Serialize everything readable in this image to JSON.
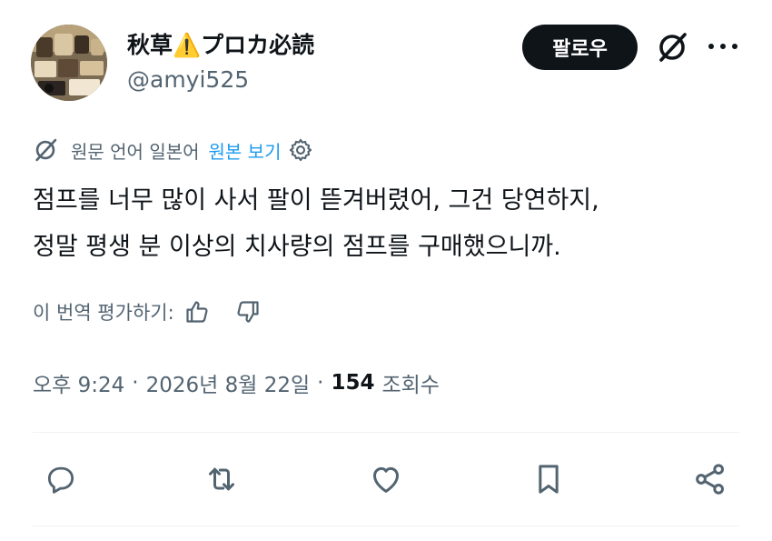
{
  "author": {
    "display_name": "秋草⚠️プロカ必読",
    "handle": "@amyi525",
    "avatar": "profile-avatar-image"
  },
  "header": {
    "follow_label": "팔로우",
    "grok_icon": "grok-icon",
    "more_icon": "more-icon"
  },
  "translation": {
    "icon": "translate-icon",
    "label": "원문 언어 일본어",
    "link": "원본 보기",
    "settings_icon": "gear-icon"
  },
  "tweet": {
    "lines": [
      "점프를 너무 많이 사서 팔이 뜯겨버렸어, 그건 당연하지,",
      "정말 평생 분 이상의 치사량의 점프를 구매했으니까."
    ]
  },
  "rating": {
    "label": "이 번역 평가하기:",
    "up_icon": "thumbs-up-icon",
    "down_icon": "thumbs-down-icon"
  },
  "meta": {
    "time": "오후 9:24",
    "separator": "·",
    "date": "2026년 8월 22일",
    "views_count": "154",
    "views_label": "조회수"
  },
  "actions": [
    "reply-icon",
    "retweet-icon",
    "like-icon",
    "bookmark-icon",
    "share-icon"
  ],
  "colors": {
    "text": "#0f1419",
    "secondary": "#536471",
    "link": "#1d9bf0",
    "button_bg": "#0f1419",
    "divider": "#eff3f4"
  }
}
